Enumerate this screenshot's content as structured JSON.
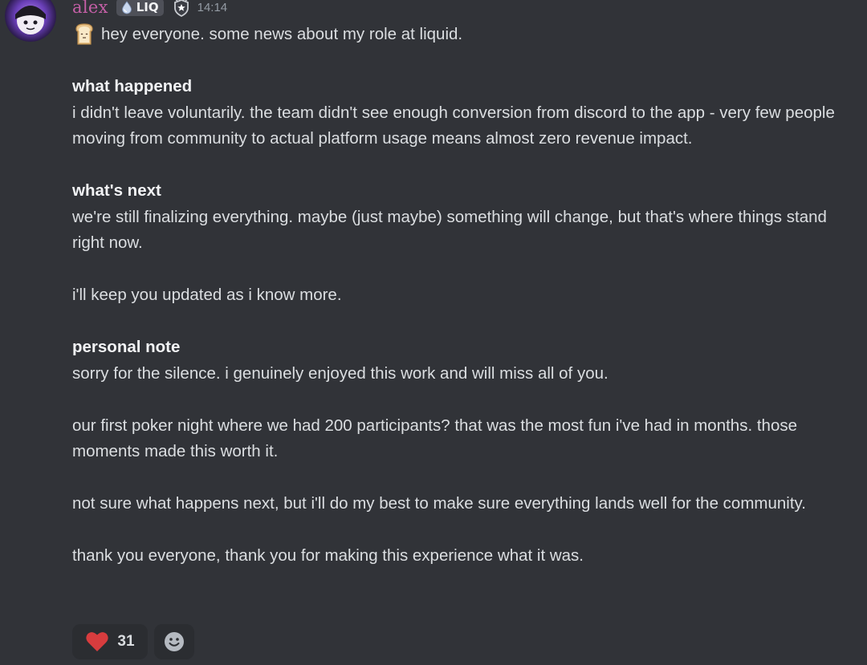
{
  "author": {
    "username": "alex",
    "tag": "LIQ",
    "timestamp": "14:14",
    "avatar_icon": "avatar-icon",
    "tag_icon": "droplet-icon",
    "role_icon": "shield-star-icon",
    "username_color": "#c45fa6"
  },
  "message": {
    "intro_emoji": "toast-emoji-icon",
    "intro": "hey everyone. some news about my role at liquid.",
    "section1_heading": "what happened",
    "section1_body": "i didn't leave voluntarily. the team didn't see enough conversion from discord to the app - very few people moving from community to actual platform usage means almost zero revenue impact.",
    "section2_heading": "what's next",
    "section2_body": "we're still finalizing everything. maybe (just maybe) something will change, but that's where things stand right now.",
    "update_line": "i'll keep you updated as i know more.",
    "section3_heading": "personal note",
    "personal_line": "sorry for the silence. i genuinely enjoyed this work and will miss all of you.",
    "poker_line": "our first poker night where we had 200 participants? that was the most fun i've had in months. those moments made this worth it.",
    "next_line": "not sure what happens next, but i'll do my best to make sure everything lands well for the community.",
    "thanks_line": "thank you everyone, thank you for making this experience what it was."
  },
  "reactions": [
    {
      "icon": "heart-icon",
      "count": "31",
      "color": "#d83c3e"
    },
    {
      "icon": "add-reaction-smile-icon"
    }
  ],
  "colors": {
    "background": "#313338",
    "text": "#dbdee1",
    "timestamp": "#949ba4",
    "reaction_bg": "#2b2d31"
  }
}
